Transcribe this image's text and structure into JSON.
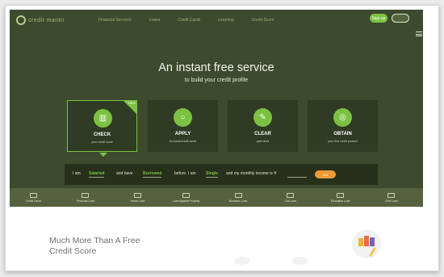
{
  "nav": {
    "logo_text": "credit mantri",
    "links": [
      "Financial Services",
      "Loans",
      "Credit Cards",
      "Learning",
      "Credit Score"
    ],
    "signin_label": "Sign up"
  },
  "hero": {
    "headline": "An instant free service",
    "subheadline": "to build your credit profile"
  },
  "cards": [
    {
      "title": "CHECK",
      "sub": "your credit score",
      "icon": "chart-icon",
      "badge": "FREE"
    },
    {
      "title": "APPLY",
      "sub": "for loans/credit cards",
      "icon": "apply-icon"
    },
    {
      "title": "CLEAR",
      "sub": "past dues",
      "icon": "clear-icon"
    },
    {
      "title": "OBTAIN",
      "sub": "your first credit product",
      "icon": "obtain-icon"
    }
  ],
  "profile": {
    "p1": "I am",
    "employment": "Salaried",
    "p2": "and have",
    "history": "Borrowed",
    "p3": "before. I am",
    "status": "Single",
    "p4": "and my monthly income is ₹",
    "go_label": "GO"
  },
  "categories": [
    "Credit Cards",
    "Personal Loan",
    "Home Loan",
    "Loan Against Property",
    "Business Loan",
    "Car Loan",
    "Education Loan",
    "Gold Loan"
  ],
  "lower": {
    "title_line1": "Much More Than A Free",
    "title_line2": "Credit Score"
  },
  "colors": {
    "accent": "#7cc242",
    "hero_bg": "#3d4a2d",
    "go_button": "#f09a36"
  }
}
